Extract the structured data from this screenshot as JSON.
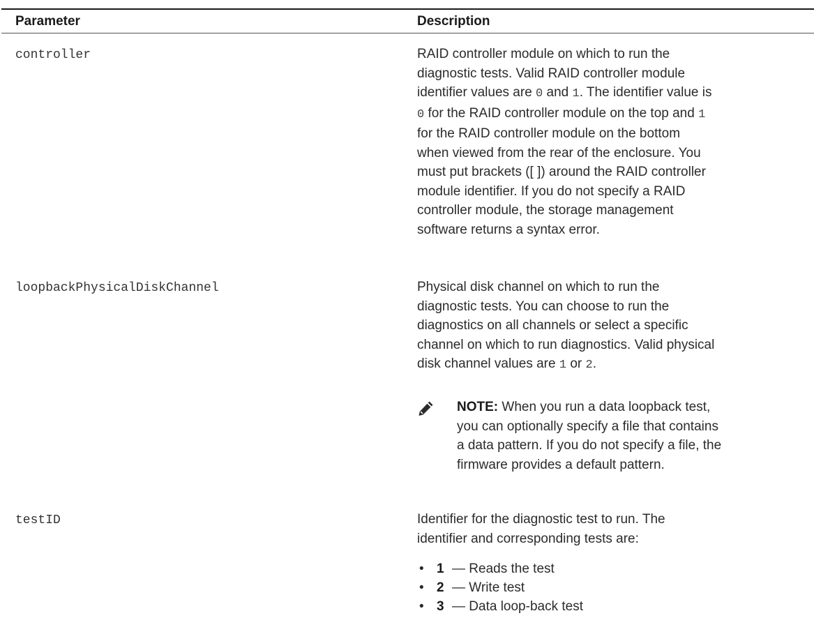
{
  "table": {
    "headers": {
      "parameter": "Parameter",
      "description": "Description"
    },
    "rows": [
      {
        "parameter": "controller",
        "description": {
          "line1": "RAID controller module on which to run the",
          "line2": "diagnostic tests. Valid RAID controller module",
          "line3a": "identifier values are ",
          "line3b": "0",
          "line3c": " and ",
          "line3d": "1",
          "line3e": ". The identifier value is",
          "line4a": "0",
          "line4b": " for the RAID controller module on the top and ",
          "line4c": "1",
          "line5": "for the RAID controller module on the bottom",
          "line6": "when viewed from the rear of the enclosure. You",
          "line7": "must put brackets ([ ]) around the RAID controller",
          "line8": "module identifier. If you do not specify a RAID",
          "line9": "controller module, the storage management",
          "line10": "software returns a syntax error."
        }
      },
      {
        "parameter": "loopbackPhysicalDiskChannel",
        "description": {
          "line1": "Physical disk channel on which to run the",
          "line2": "diagnostic tests. You can choose to run the",
          "line3": "diagnostics on all channels or select a specific",
          "line4": "channel on which to run diagnostics. Valid physical",
          "line5a": "disk channel values are ",
          "line5b": "1",
          "line5c": " or ",
          "line5d": "2",
          "line5e": "."
        },
        "note": {
          "label": "NOTE:",
          "line1": " When you run a data loopback test,",
          "line2": "you can optionally specify a file that contains",
          "line3": "a data pattern. If you do not specify a file, the",
          "line4": "firmware provides a default pattern."
        }
      },
      {
        "parameter": "testID",
        "description": {
          "line1": "Identifier for the diagnostic test to run. The",
          "line2": "identifier and corresponding tests are:"
        },
        "tests": [
          {
            "bullet": "•",
            "id": "1",
            "text": "— Reads the test"
          },
          {
            "bullet": "•",
            "id": "2",
            "text": "— Write test"
          },
          {
            "bullet": "•",
            "id": "3",
            "text": "— Data loop-back test"
          }
        ]
      }
    ]
  },
  "icons": {
    "note": "pencil-note-icon"
  }
}
